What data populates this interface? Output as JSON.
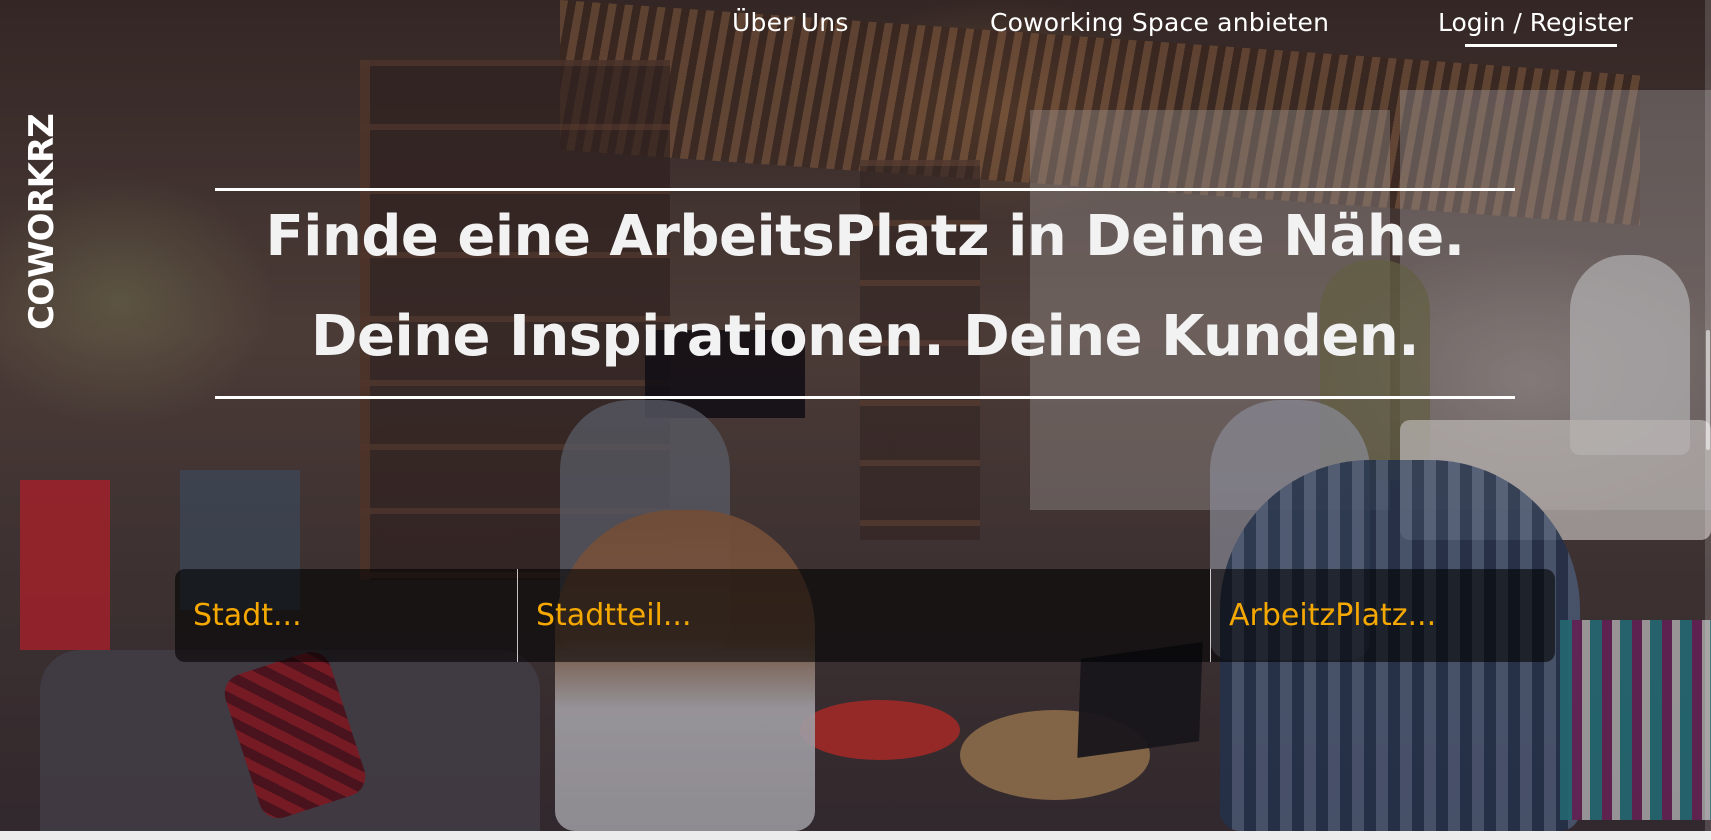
{
  "nav": {
    "about_label": "Über Uns",
    "offer_space_label": "Coworking Space anbieten",
    "login_label": "Login",
    "separator": "/",
    "register_label": "Register"
  },
  "logo": {
    "text": "COWORKRZ"
  },
  "hero": {
    "headline_line1": "Finde eine ArbeitsPlatz in Deine Nähe.",
    "headline_line2": "Deine Inspirationen. Deine Kunden."
  },
  "search": {
    "city": "Stadt...",
    "district": "Stadtteil...",
    "workspace": "ArbeitzPlatz..."
  },
  "colors": {
    "accent": "#f5a800",
    "text": "#ffffff"
  }
}
